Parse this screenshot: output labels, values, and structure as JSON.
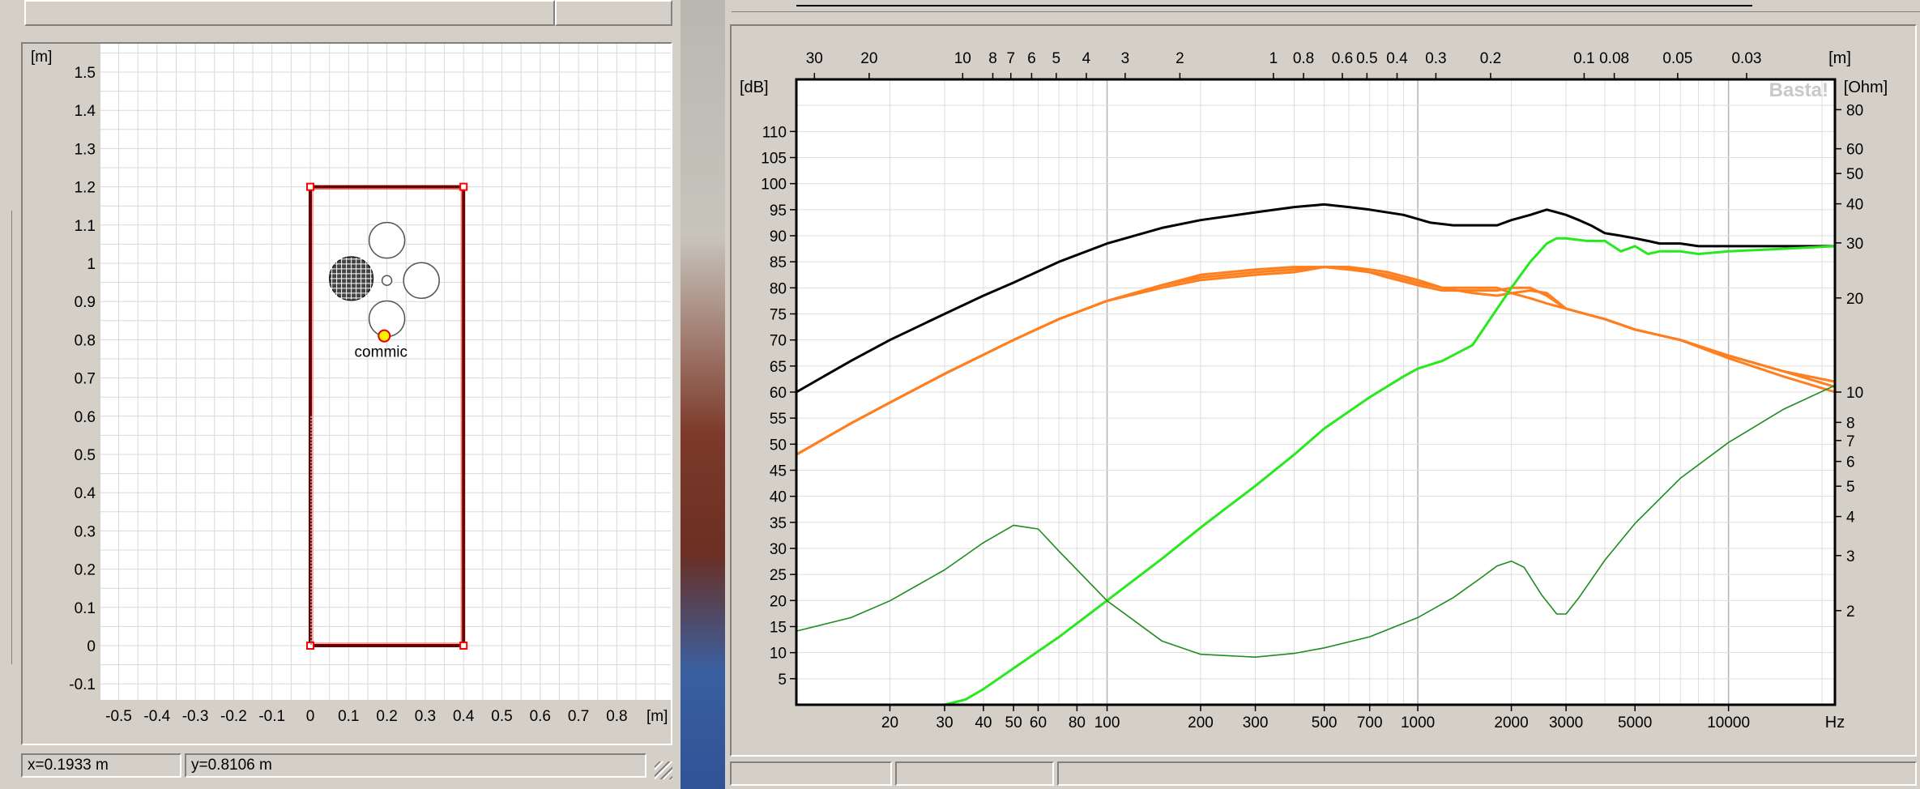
{
  "room_plot": {
    "x_unit": "[m]",
    "y_unit": "[m]",
    "x_ticks": [
      "-0.5",
      "-0.4",
      "-0.3",
      "-0.2",
      "-0.1",
      "0",
      "0.1",
      "0.2",
      "0.3",
      "0.4",
      "0.5",
      "0.6",
      "0.7",
      "0.8"
    ],
    "y_ticks": [
      "1.5",
      "1.4",
      "1.3",
      "1.2",
      "1.1",
      "1",
      "0.9",
      "0.8",
      "0.7",
      "0.6",
      "0.5",
      "0.4",
      "0.3",
      "0.2",
      "0.1",
      "0",
      "-0.1"
    ],
    "mic_label": "commic",
    "status_x": "x=0.1933 m",
    "status_y": "y=0.8106 m"
  },
  "chart_data": {
    "type": "line",
    "xlabel": "Hz",
    "ylabel": "[dB]",
    "y2label": "[Ohm]",
    "top_axis_unit": "[m]",
    "watermark": "Basta!",
    "x_scale": "log",
    "xlim": [
      10,
      22000
    ],
    "ylim": [
      0,
      120
    ],
    "y2lim": [
      1,
      100
    ],
    "y2_scale": "log",
    "x_tick_labels": [
      "20",
      "30",
      "40",
      "50",
      "60",
      "80",
      "100",
      "200",
      "300",
      "500",
      "700",
      "1000",
      "2000",
      "3000",
      "5000",
      "10000"
    ],
    "y_tick_labels": [
      "5",
      "10",
      "15",
      "20",
      "25",
      "30",
      "35",
      "40",
      "45",
      "50",
      "55",
      "60",
      "65",
      "70",
      "75",
      "80",
      "85",
      "90",
      "95",
      "100",
      "105",
      "110"
    ],
    "y2_tick_labels": [
      "2",
      "3",
      "4",
      "5",
      "6",
      "7",
      "8",
      "10",
      "20",
      "30",
      "40",
      "50",
      "60",
      "80"
    ],
    "top_tick_labels": [
      "30",
      "20",
      "10",
      "8",
      "7",
      "6",
      "5",
      "4",
      "3",
      "2",
      "1",
      "0.8",
      "0.6",
      "0.5",
      "0.4",
      "0.3",
      "0.2",
      "0.1",
      "0.08",
      "0.05",
      "0.03"
    ],
    "grid": true,
    "series": [
      {
        "color": "#000000",
        "axis": "left",
        "x": [
          10,
          15,
          20,
          30,
          40,
          50,
          70,
          100,
          150,
          200,
          300,
          400,
          500,
          600,
          700,
          900,
          1100,
          1300,
          1500,
          1800,
          2000,
          2300,
          2600,
          2800,
          3000,
          3300,
          3600,
          4000,
          4500,
          5000,
          5500,
          6000,
          7000,
          8000,
          10000,
          12000,
          15000,
          22000
        ],
        "y": [
          60,
          66,
          70,
          75,
          78.5,
          81,
          85,
          88.5,
          91.5,
          93,
          94.5,
          95.5,
          96,
          95.5,
          95,
          94,
          92.5,
          92,
          92,
          92,
          93,
          94,
          95,
          94.5,
          94,
          93,
          92,
          90.5,
          90,
          89.5,
          89,
          88.5,
          88.5,
          88,
          88,
          88,
          88,
          88
        ]
      },
      {
        "color": "#ff7f1e",
        "axis": "left",
        "x": [
          10,
          15,
          20,
          30,
          50,
          70,
          100,
          150,
          200,
          300,
          400,
          500,
          600,
          700,
          800,
          1000,
          1200,
          1500,
          1800,
          2000,
          2300,
          2600,
          3000,
          4000,
          5000,
          7000,
          10000,
          15000,
          22000
        ],
        "y": [
          48,
          54,
          58,
          63.5,
          70,
          74,
          77.5,
          80.5,
          82,
          83,
          83.5,
          84,
          84,
          83,
          82.5,
          81,
          80,
          80,
          80,
          79,
          78,
          77,
          76,
          74,
          72,
          70,
          67,
          64,
          62
        ]
      },
      {
        "color": "#ff7f1e",
        "axis": "left",
        "x": [
          10,
          15,
          20,
          30,
          50,
          70,
          100,
          150,
          200,
          300,
          400,
          500,
          600,
          700,
          800,
          1000,
          1200,
          1500,
          1800,
          2000,
          2300,
          2600,
          3000,
          4000,
          5000,
          7000,
          10000,
          15000,
          22000
        ],
        "y": [
          48,
          54,
          58,
          63.5,
          70,
          74,
          77.5,
          80.5,
          82.5,
          83.5,
          84,
          84,
          83.5,
          83,
          82,
          80.5,
          79.5,
          79.5,
          79.5,
          80,
          80,
          78.5,
          76,
          74,
          72,
          70,
          67,
          64,
          61
        ]
      },
      {
        "color": "#ff7f1e",
        "axis": "left",
        "x": [
          10,
          15,
          20,
          30,
          50,
          70,
          100,
          150,
          200,
          300,
          400,
          500,
          600,
          700,
          800,
          1000,
          1200,
          1500,
          1800,
          2000,
          2300,
          2600,
          3000,
          4000,
          5000,
          7000,
          10000,
          15000,
          22000
        ],
        "y": [
          48,
          54,
          58,
          63.5,
          70,
          74,
          77.5,
          80,
          81.5,
          82.5,
          83,
          84,
          84,
          83.5,
          83,
          81.5,
          80,
          79,
          78.5,
          79,
          79.5,
          79,
          76,
          74,
          72,
          70,
          66.5,
          63,
          60
        ]
      },
      {
        "color": "#28e81e",
        "axis": "left",
        "x": [
          10,
          20,
          30,
          35,
          40,
          50,
          70,
          100,
          150,
          200,
          300,
          400,
          500,
          700,
          900,
          1000,
          1200,
          1500,
          1800,
          2000,
          2300,
          2600,
          2800,
          3000,
          3500,
          4000,
          4500,
          5000,
          5500,
          6000,
          7000,
          8000,
          10000,
          15000,
          22000
        ],
        "y": [
          0,
          0,
          0,
          1,
          3,
          7,
          13,
          20,
          28,
          34,
          42,
          48,
          53,
          59,
          63,
          64.5,
          66,
          69,
          76,
          80,
          85,
          88.5,
          89.5,
          89.5,
          89,
          89,
          87,
          88,
          86.5,
          87,
          87,
          86.5,
          87,
          87.5,
          88
        ]
      },
      {
        "color": "#1e8c1e",
        "axis": "right",
        "x": [
          10,
          15,
          20,
          30,
          40,
          50,
          60,
          70,
          100,
          150,
          200,
          300,
          400,
          500,
          700,
          1000,
          1300,
          1600,
          1800,
          2000,
          2200,
          2500,
          2800,
          3000,
          3300,
          4000,
          5000,
          7000,
          10000,
          15000,
          22000
        ],
        "y": [
          1.72,
          1.9,
          2.15,
          2.7,
          3.3,
          3.75,
          3.65,
          3.1,
          2.15,
          1.6,
          1.45,
          1.42,
          1.46,
          1.52,
          1.65,
          1.9,
          2.2,
          2.55,
          2.78,
          2.88,
          2.75,
          2.25,
          1.95,
          1.95,
          2.2,
          2.9,
          3.8,
          5.3,
          6.9,
          8.8,
          10.5
        ]
      }
    ]
  }
}
